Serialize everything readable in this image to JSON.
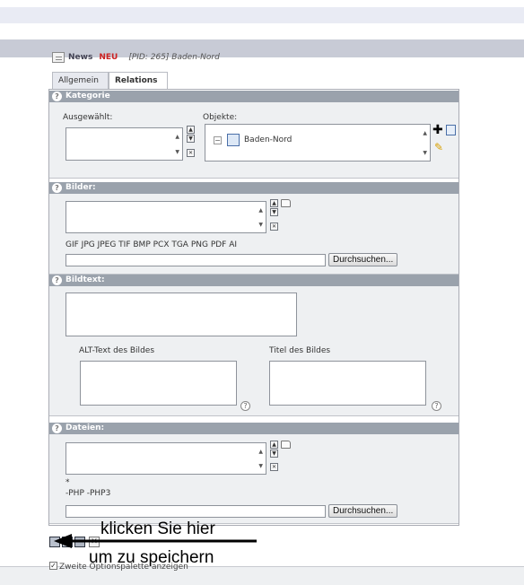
{
  "title": {
    "news": "News",
    "neu": "NEU",
    "record": "[PID: 265] Baden-Nord"
  },
  "tabs": [
    "Allgemein",
    "Relations"
  ],
  "kategorie": {
    "heading": "Kategorie",
    "selected_label": "Ausgewählt:",
    "objects_label": "Objekte:",
    "tree_item": "Baden-Nord"
  },
  "bilder": {
    "heading": "Bilder:",
    "allowed_types": "GIF JPG JPEG TIF BMP PCX TGA PNG PDF AI",
    "browse_label": "Durchsuchen..."
  },
  "bildtext": {
    "heading": "Bildtext:",
    "alt_label": "ALT-Text des Bildes",
    "title_label": "Titel des Bildes"
  },
  "dateien": {
    "heading": "Dateien:",
    "allowed_line1": "*",
    "allowed_line2": "-PHP -PHP3",
    "browse_label": "Durchsuchen..."
  },
  "footer": {
    "checkbox_label": "Zweite Optionspalette anzeigen"
  },
  "callout": {
    "line1": "klicken Sie hier",
    "line2": "um zu speichern"
  },
  "help_glyph": "?",
  "icons": [
    "document-icon",
    "add-icon",
    "edit-icon",
    "folder-icon",
    "save-icon",
    "close-icon",
    "help-icon",
    "tree-minus-icon",
    "arrow-left-icon"
  ]
}
